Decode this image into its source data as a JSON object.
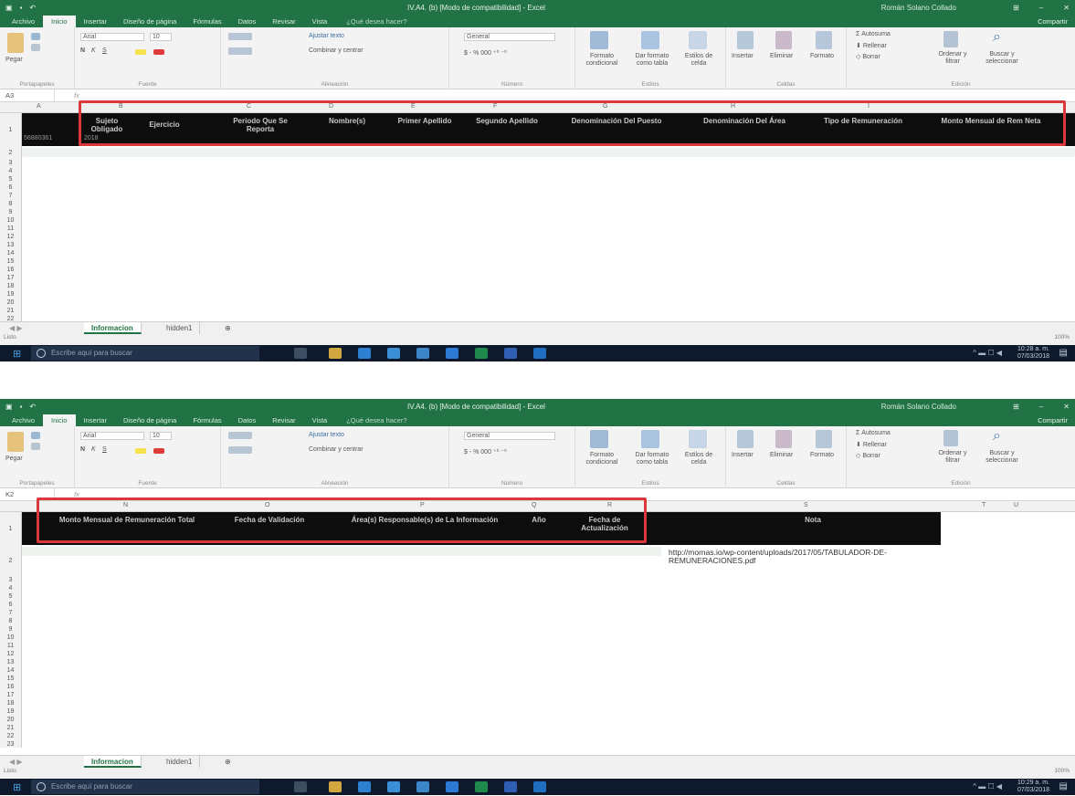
{
  "app": {
    "window_title": "IV.A4. (b) [Modo de compatibilidad] - Excel",
    "user_name": "Román Solano Collado",
    "qat_icons": [
      "excel-logo-icon",
      "save-icon",
      "undo-icon"
    ],
    "window_controls": [
      "ribbon-display-icon",
      "minimize-icon",
      "maximize-icon",
      "close-icon"
    ]
  },
  "ribbon_tabs": [
    "Archivo",
    "Inicio",
    "Insertar",
    "Diseño de página",
    "Fórmulas",
    "Datos",
    "Revisar",
    "Vista"
  ],
  "active_tab": "Inicio",
  "tell_me": "¿Qué desea hacer?",
  "share_label": "Compartir",
  "ribbon": {
    "clipboard": {
      "paste": "Pegar",
      "group": "Portapapeles"
    },
    "font": {
      "name": "Arial",
      "size": "10",
      "group": "Fuente",
      "bold": "N",
      "italic": "K",
      "underline": "S"
    },
    "alignment": {
      "wrap": "Ajustar texto",
      "merge": "Combinar y centrar",
      "group": "Alineación"
    },
    "number": {
      "format": "General",
      "group": "Número"
    },
    "styles": {
      "conditional": "Formato condicional",
      "as_table": "Dar formato como tabla",
      "cell_styles": "Estilos de celda",
      "group": "Estilos"
    },
    "cells": {
      "insert": "Insertar",
      "delete": "Eliminar",
      "format": "Formato",
      "group": "Celdas"
    },
    "editing": {
      "autosum": "Autosuma",
      "fill": "Rellenar",
      "clear": "Borrar",
      "sort": "Ordenar y filtrar",
      "find": "Buscar y seleccionar",
      "group": "Edición"
    }
  },
  "screen1": {
    "name_box": "A3",
    "fx": "fx",
    "columns": [
      "A",
      "B",
      "C",
      "D",
      "E",
      "F",
      "G",
      "H",
      "I"
    ],
    "headers": [
      "Sujeto Obligado",
      "Ejercicio",
      "Periodo Que Se Reporta",
      "Nombre(s)",
      "Primer Apellido",
      "Segundo Apellido",
      "Denominación Del Puesto",
      "Denominación Del Área",
      "Tipo de Remuneración",
      "Monto Mensual de Rem Neta"
    ],
    "row2_value": "56880361",
    "row2_value_b": "2018",
    "rows": [
      "1",
      "2",
      "3",
      "4",
      "5",
      "6",
      "7",
      "8",
      "9",
      "10",
      "11",
      "12",
      "13",
      "14",
      "15",
      "16",
      "17",
      "18",
      "19",
      "20",
      "21",
      "22",
      "23"
    ]
  },
  "screen2": {
    "name_box": "K2",
    "fx": "fx",
    "columns": [
      "N",
      "O",
      "P",
      "Q",
      "R",
      "S",
      "T",
      "U"
    ],
    "headers": [
      "Monto Mensual de Remuneración Total",
      "Fecha de Validación",
      "Área(s) Responsable(s) de La Información",
      "Año",
      "Fecha de Actualización",
      "Nota"
    ],
    "link": "http://mornas.io/wp-content/uploads/2017/05/TABULADOR-DE-REMUNERACIONES.pdf",
    "rows": [
      "1",
      "2",
      "3",
      "4",
      "5",
      "6",
      "7",
      "8",
      "9",
      "10",
      "11",
      "12",
      "13",
      "14",
      "15",
      "16",
      "17",
      "18",
      "19",
      "20",
      "21",
      "22",
      "23"
    ]
  },
  "sheet_tabs": [
    "Informacion",
    "hidden1"
  ],
  "status": "Listo",
  "zoom": "100%",
  "taskbar": {
    "search_placeholder": "Escribe aquí para buscar",
    "time1": "10:28 a. m.",
    "date1": "07/03/2018",
    "time2": "10:29 a. m.",
    "date2": "07/03/2018",
    "colors": {
      "excel_green": "#217346",
      "header_black": "#0d0d0d",
      "highlight_red": "#d9393a",
      "taskbar": "#0e1a2b"
    }
  }
}
